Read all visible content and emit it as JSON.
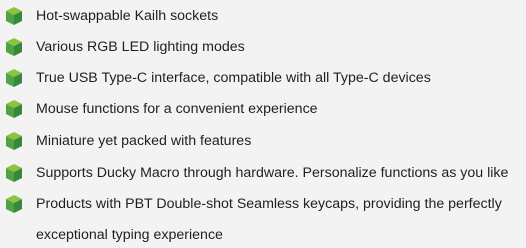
{
  "colors": {
    "background": "#f3f3f3",
    "text": "#1f1f1f",
    "bullet_top": "#8bc53f",
    "bullet_left": "#4ea345",
    "bullet_right": "#37873c"
  },
  "bullet_icon": "green-cube-icon",
  "features": [
    {
      "text": "Hot-swappable Kailh sockets"
    },
    {
      "text": "Various RGB LED lighting modes"
    },
    {
      "text": "True USB Type-C interface, compatible with all Type-C devices"
    },
    {
      "text": "Mouse functions for a convenient experience"
    },
    {
      "text": "Miniature yet packed with features"
    },
    {
      "text": "Supports Ducky Macro through hardware. Personalize functions as you like"
    },
    {
      "text": "Products with PBT Double-shot Seamless keycaps, providing the perfectly"
    },
    {
      "text": "exceptional typing experience"
    }
  ]
}
